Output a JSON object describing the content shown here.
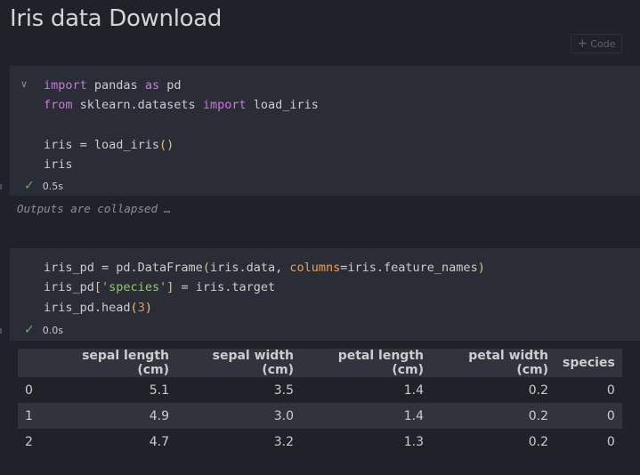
{
  "notebook": {
    "title": "Iris data Download",
    "add_code_label": "Code"
  },
  "cell1": {
    "lines": [
      "import pandas as pd",
      "from sklearn.datasets import load_iris",
      "",
      "iris = load_iris()",
      "iris"
    ],
    "exec_time": "0.5s",
    "outputs_collapsed": "Outputs are collapsed …"
  },
  "cell2": {
    "lines": [
      "iris_pd = pd.DataFrame(iris.data, columns=iris.feature_names)",
      "iris_pd['species'] = iris.target",
      "iris_pd.head(3)"
    ],
    "exec_time": "0.0s"
  },
  "output_table": {
    "columns": [
      "",
      "sepal length (cm)",
      "sepal width (cm)",
      "petal length (cm)",
      "petal width (cm)",
      "species"
    ],
    "rows": [
      [
        "0",
        "5.1",
        "3.5",
        "1.4",
        "0.2",
        "0"
      ],
      [
        "1",
        "4.9",
        "3.0",
        "1.4",
        "0.2",
        "0"
      ],
      [
        "2",
        "4.7",
        "3.2",
        "1.3",
        "0.2",
        "0"
      ]
    ]
  },
  "colors": {
    "background": "#1f2229",
    "cell_background": "#2a2d35",
    "keyword": "#c678dd",
    "string": "#98c379",
    "success_check": "#6aae5b"
  },
  "icons": {
    "status": "check-icon",
    "fold": "chevron-down-icon",
    "add": "plus-icon"
  }
}
